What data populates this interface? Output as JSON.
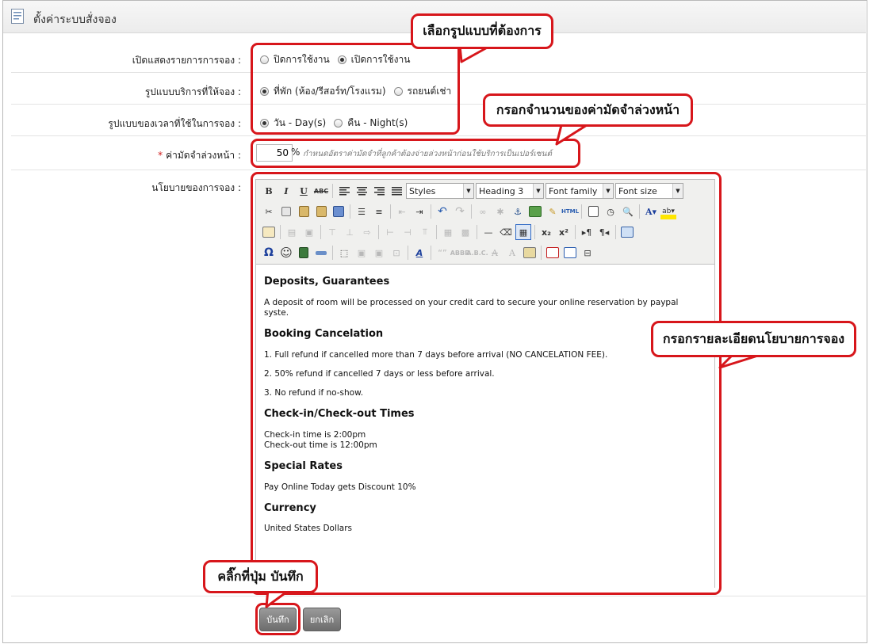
{
  "page": {
    "title": "ตั้งค่าระบบสั่งจอง"
  },
  "form": {
    "show_booking": {
      "label": "เปิดแสดงรายการการจอง :",
      "options": [
        {
          "label": "ปิดการใช้งาน",
          "selected": false
        },
        {
          "label": "เปิดการใช้งาน",
          "selected": true
        }
      ]
    },
    "service_type": {
      "label": "รูปแบบบริการที่ให้จอง :",
      "options": [
        {
          "label": "ที่พัก (ห้อง/รีสอร์ท/โรงแรม)",
          "selected": true
        },
        {
          "label": "รถยนต์เช่า",
          "selected": false
        }
      ]
    },
    "time_unit": {
      "label": "รูปแบบของเวลาที่ใช้ในการจอง :",
      "options": [
        {
          "label": "วัน - Day(s)",
          "selected": true
        },
        {
          "label": "คืน - Night(s)",
          "selected": false
        }
      ]
    },
    "deposit": {
      "label": "ค่ามัดจำล่วงหน้า :",
      "required_mark": "*",
      "value": "50",
      "unit": "%",
      "hint": "กำหนดอัตราค่ามัดจำที่ลูกค้าต้องจ่ายล่วงหน้าก่อนใช้บริการเป็นเปอร์เซนต์"
    },
    "policy": {
      "label": "นโยบายของการจอง :"
    }
  },
  "editor": {
    "selects": {
      "styles": "Styles",
      "format": "Heading 3",
      "font_family": "Font family",
      "font_size": "Font size"
    },
    "content": {
      "h1": "Deposits, Guarantees",
      "p1": "A deposit of room will be processed on your credit card to secure your online reservation by paypal syste.",
      "h2": "Booking Cancelation",
      "p2": "1. Full refund if cancelled more than 7 days before arrival (NO CANCELATION FEE).",
      "p3": "2. 50% refund if cancelled 7 days or less before arrival.",
      "p4": "3. No refund if no-show.",
      "h3": "Check-in/Check-out Times",
      "p5": "Check-in time is 2:00pm",
      "p6": "Check-out time is 12:00pm",
      "h4": "Special Rates",
      "p7": "Pay Online Today gets Discount 10%",
      "h5": "Currency",
      "p8": "United States Dollars"
    }
  },
  "buttons": {
    "save": "บันทึก",
    "cancel": "ยกเลิก"
  },
  "callouts": {
    "choose_format": "เลือกรูปแบบที่ต้องการ",
    "enter_deposit": "กรอกจำนวนของค่ามัดจำล่วงหน้า",
    "enter_policy": "กรอกรายละเอียดนโยบายการจอง",
    "click_save": "คลิ๊กที่ปุ่ม บันทึก"
  },
  "colors": {
    "callout_red": "#d7161b",
    "button_gray": "#7d7d7d"
  }
}
